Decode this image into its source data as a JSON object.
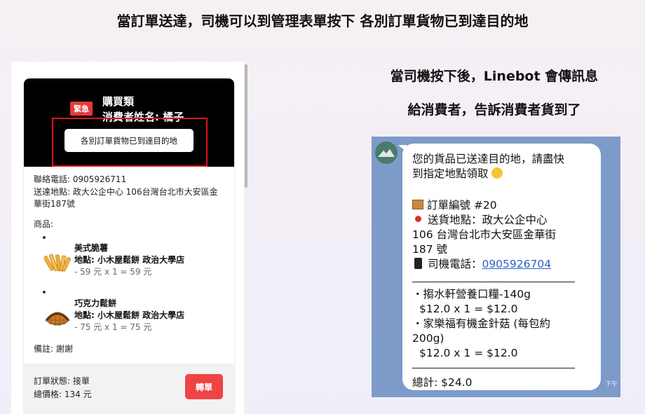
{
  "page": {
    "heading": "當訂單送達，司機可以到管理表單按下 各別訂單貨物已到達目的地",
    "sub_heading_1": "當司機按下後，Linebot 會傳訊息",
    "sub_heading_2": "給消費者，告訴消費者貨到了"
  },
  "order_card": {
    "urgent_badge": "緊急",
    "category": "購買類",
    "consumer_name": "消費者姓名: 橘子",
    "arrived_button": "各別訂單貨物已到達目的地",
    "phone": "聯絡電話: 0905926711",
    "address": "送達地點: 政大公企中心 106台灣台北市大安區金華街187號",
    "goods_label": "商品:",
    "items": [
      {
        "name": "美式脆薯",
        "location": "地點: 小木屋鬆餅 政治大學店",
        "price": "- 59 元 x 1 = 59 元",
        "icon": "fries-icon"
      },
      {
        "name": "巧克力鬆餅",
        "location": "地點: 小木屋鬆餅 政治大學店",
        "price": "- 75 元 x 1 = 75 元",
        "icon": "waffle-icon"
      }
    ],
    "note": "備註: 謝謝",
    "status": "訂單狀態: 接單",
    "total": "總價格: 134 元",
    "transfer_button": "轉單",
    "colors": {
      "urgent": "#e43a3a",
      "transfer": "#ef4444",
      "highlight": "#e0141e"
    }
  },
  "line_chat": {
    "avatar_icon": "mountain-avatar-icon",
    "intro_line_1": "您的貨品已送達目的地，請盡快",
    "intro_line_2": "到指定地點領取",
    "order_number": "訂單編號 #20",
    "delivery_address_1": "送貨地點：政大公企中心",
    "delivery_address_2": "106 台灣台北市大安區金華街",
    "delivery_address_3": "187 號",
    "phone_label": "司機電話：",
    "phone_number": "0905926704",
    "item_1_name": "・搊水軒營養口糧-140g",
    "item_1_price": "$12.0 x 1 = $12.0",
    "item_2_name_1": "・家樂福有機金針菇 (每包約",
    "item_2_name_2": "200g)",
    "item_2_price": "$12.0 x 1 = $12.0",
    "total": "總計: $24.0",
    "time": "下午",
    "colors": {
      "background": "#7d9bc9",
      "link": "#2a62c9"
    }
  }
}
